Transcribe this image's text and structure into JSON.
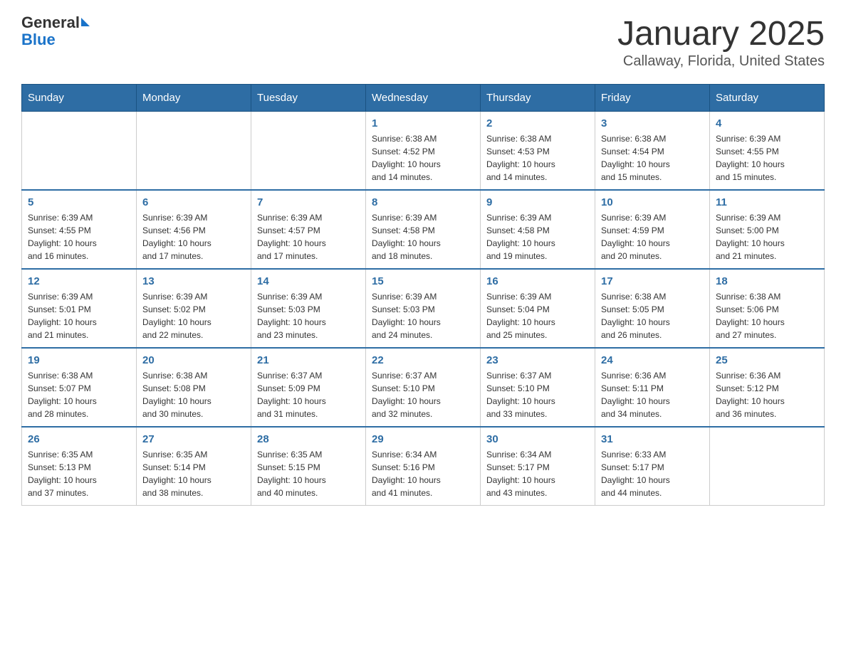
{
  "logo": {
    "text_general": "General",
    "text_blue": "Blue"
  },
  "title": "January 2025",
  "subtitle": "Callaway, Florida, United States",
  "days_of_week": [
    "Sunday",
    "Monday",
    "Tuesday",
    "Wednesday",
    "Thursday",
    "Friday",
    "Saturday"
  ],
  "weeks": [
    [
      {
        "day": "",
        "info": ""
      },
      {
        "day": "",
        "info": ""
      },
      {
        "day": "",
        "info": ""
      },
      {
        "day": "1",
        "info": "Sunrise: 6:38 AM\nSunset: 4:52 PM\nDaylight: 10 hours\nand 14 minutes."
      },
      {
        "day": "2",
        "info": "Sunrise: 6:38 AM\nSunset: 4:53 PM\nDaylight: 10 hours\nand 14 minutes."
      },
      {
        "day": "3",
        "info": "Sunrise: 6:38 AM\nSunset: 4:54 PM\nDaylight: 10 hours\nand 15 minutes."
      },
      {
        "day": "4",
        "info": "Sunrise: 6:39 AM\nSunset: 4:55 PM\nDaylight: 10 hours\nand 15 minutes."
      }
    ],
    [
      {
        "day": "5",
        "info": "Sunrise: 6:39 AM\nSunset: 4:55 PM\nDaylight: 10 hours\nand 16 minutes."
      },
      {
        "day": "6",
        "info": "Sunrise: 6:39 AM\nSunset: 4:56 PM\nDaylight: 10 hours\nand 17 minutes."
      },
      {
        "day": "7",
        "info": "Sunrise: 6:39 AM\nSunset: 4:57 PM\nDaylight: 10 hours\nand 17 minutes."
      },
      {
        "day": "8",
        "info": "Sunrise: 6:39 AM\nSunset: 4:58 PM\nDaylight: 10 hours\nand 18 minutes."
      },
      {
        "day": "9",
        "info": "Sunrise: 6:39 AM\nSunset: 4:58 PM\nDaylight: 10 hours\nand 19 minutes."
      },
      {
        "day": "10",
        "info": "Sunrise: 6:39 AM\nSunset: 4:59 PM\nDaylight: 10 hours\nand 20 minutes."
      },
      {
        "day": "11",
        "info": "Sunrise: 6:39 AM\nSunset: 5:00 PM\nDaylight: 10 hours\nand 21 minutes."
      }
    ],
    [
      {
        "day": "12",
        "info": "Sunrise: 6:39 AM\nSunset: 5:01 PM\nDaylight: 10 hours\nand 21 minutes."
      },
      {
        "day": "13",
        "info": "Sunrise: 6:39 AM\nSunset: 5:02 PM\nDaylight: 10 hours\nand 22 minutes."
      },
      {
        "day": "14",
        "info": "Sunrise: 6:39 AM\nSunset: 5:03 PM\nDaylight: 10 hours\nand 23 minutes."
      },
      {
        "day": "15",
        "info": "Sunrise: 6:39 AM\nSunset: 5:03 PM\nDaylight: 10 hours\nand 24 minutes."
      },
      {
        "day": "16",
        "info": "Sunrise: 6:39 AM\nSunset: 5:04 PM\nDaylight: 10 hours\nand 25 minutes."
      },
      {
        "day": "17",
        "info": "Sunrise: 6:38 AM\nSunset: 5:05 PM\nDaylight: 10 hours\nand 26 minutes."
      },
      {
        "day": "18",
        "info": "Sunrise: 6:38 AM\nSunset: 5:06 PM\nDaylight: 10 hours\nand 27 minutes."
      }
    ],
    [
      {
        "day": "19",
        "info": "Sunrise: 6:38 AM\nSunset: 5:07 PM\nDaylight: 10 hours\nand 28 minutes."
      },
      {
        "day": "20",
        "info": "Sunrise: 6:38 AM\nSunset: 5:08 PM\nDaylight: 10 hours\nand 30 minutes."
      },
      {
        "day": "21",
        "info": "Sunrise: 6:37 AM\nSunset: 5:09 PM\nDaylight: 10 hours\nand 31 minutes."
      },
      {
        "day": "22",
        "info": "Sunrise: 6:37 AM\nSunset: 5:10 PM\nDaylight: 10 hours\nand 32 minutes."
      },
      {
        "day": "23",
        "info": "Sunrise: 6:37 AM\nSunset: 5:10 PM\nDaylight: 10 hours\nand 33 minutes."
      },
      {
        "day": "24",
        "info": "Sunrise: 6:36 AM\nSunset: 5:11 PM\nDaylight: 10 hours\nand 34 minutes."
      },
      {
        "day": "25",
        "info": "Sunrise: 6:36 AM\nSunset: 5:12 PM\nDaylight: 10 hours\nand 36 minutes."
      }
    ],
    [
      {
        "day": "26",
        "info": "Sunrise: 6:35 AM\nSunset: 5:13 PM\nDaylight: 10 hours\nand 37 minutes."
      },
      {
        "day": "27",
        "info": "Sunrise: 6:35 AM\nSunset: 5:14 PM\nDaylight: 10 hours\nand 38 minutes."
      },
      {
        "day": "28",
        "info": "Sunrise: 6:35 AM\nSunset: 5:15 PM\nDaylight: 10 hours\nand 40 minutes."
      },
      {
        "day": "29",
        "info": "Sunrise: 6:34 AM\nSunset: 5:16 PM\nDaylight: 10 hours\nand 41 minutes."
      },
      {
        "day": "30",
        "info": "Sunrise: 6:34 AM\nSunset: 5:17 PM\nDaylight: 10 hours\nand 43 minutes."
      },
      {
        "day": "31",
        "info": "Sunrise: 6:33 AM\nSunset: 5:17 PM\nDaylight: 10 hours\nand 44 minutes."
      },
      {
        "day": "",
        "info": ""
      }
    ]
  ],
  "colors": {
    "header_bg": "#2e6da4",
    "header_text": "#ffffff",
    "day_number": "#2e6da4",
    "row_border": "#2e6da4"
  }
}
